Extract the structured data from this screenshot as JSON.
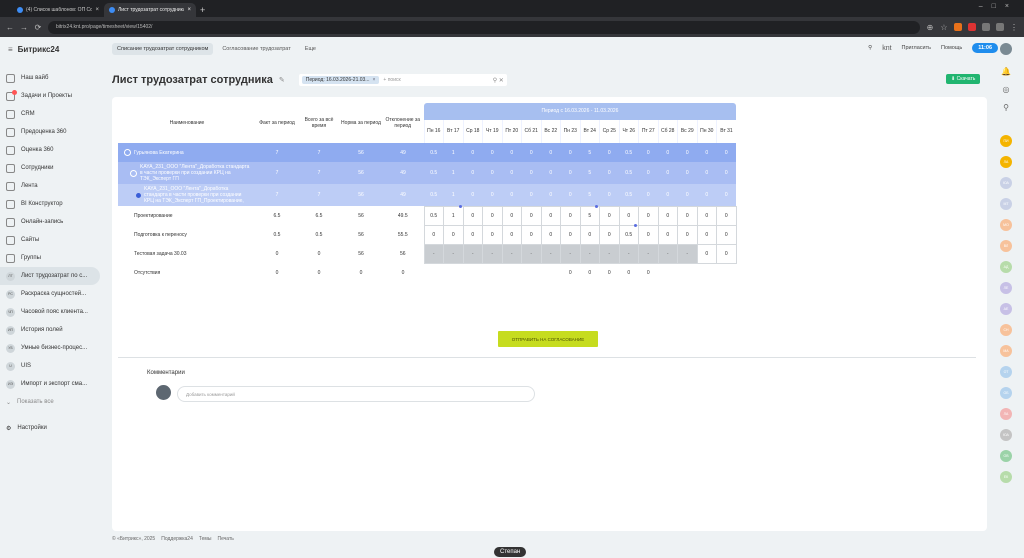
{
  "browser": {
    "tabs": [
      {
        "title": "(4) Список шаблонов: ОП Со..."
      },
      {
        "title": "Лист трудозатрат сотрудника"
      }
    ],
    "url": "bitrix24.knt.pro/page/timesheet/view/15402/"
  },
  "header": {
    "logo": "Битрикс24",
    "tabs": [
      "Списание трудозатрат сотрудником",
      "Согласование трудозатрат",
      "Еще"
    ],
    "knt": "knt",
    "invite": "Пригласить",
    "help": "Помощь",
    "clock": "11:06"
  },
  "sidebar": {
    "items": [
      {
        "label": "Наш вайб"
      },
      {
        "label": "Задачи и Проекты"
      },
      {
        "label": "CRM"
      },
      {
        "label": "Предоценка 360"
      },
      {
        "label": "Оценка 360"
      },
      {
        "label": "Сотрудники"
      },
      {
        "label": "Лента"
      },
      {
        "label": "BI Конструктор"
      },
      {
        "label": "Онлайн-запись"
      },
      {
        "label": "Сайты"
      },
      {
        "label": "Группы"
      },
      {
        "label": "Лист трудозатрат по с...",
        "icon_text": "ЛТ"
      },
      {
        "label": "Раскраска сущностей...",
        "icon_text": "РС"
      },
      {
        "label": "Часовой пояс клиента...",
        "icon_text": "ЧП"
      },
      {
        "label": "История полей",
        "icon_text": "ИП"
      },
      {
        "label": "Умные бизнес-процес...",
        "icon_text": "УБ"
      },
      {
        "label": "UIS",
        "icon_text": "U"
      },
      {
        "label": "Импорт и экспорт сма...",
        "icon_text": "ИЭ"
      }
    ],
    "show_all": "Показать все",
    "settings": "Настройки"
  },
  "page": {
    "title": "Лист трудозатрат сотрудника",
    "filter_chip": "Период: 16.03.2026-21.03...",
    "search_placeholder": "+ поиск",
    "export_label": "Скачать"
  },
  "table": {
    "headers": {
      "name": "Наименование",
      "fact": "Факт за период",
      "total": "Всего за всё время",
      "norm": "Норма за период",
      "deviation": "Отклонение за период"
    },
    "period_label": "Период с 16.03.2026 - 11.03.2026",
    "days": [
      "Пн 16",
      "Вт 17",
      "Ср 18",
      "Чт 19",
      "Пт 20",
      "Сб 21",
      "Вс 22",
      "Пн 23",
      "Вт 24",
      "Ср 25",
      "Чт 26",
      "Пт 27",
      "Сб 28",
      "Вс 29",
      "Пн 30",
      "Вт 31"
    ],
    "rows": [
      {
        "name": "Гурьянова Екатерина",
        "fact": "7",
        "total": "7",
        "norm": "56",
        "dev": "49",
        "cells": [
          "0.5",
          "1",
          "0",
          "0",
          "0",
          "0",
          "0",
          "0",
          "5",
          "0",
          "0.5",
          "0",
          "0",
          "0",
          "0",
          "0"
        ]
      },
      {
        "name": "KAYA_231_ООО \"Лента\"_Доработка стандарта в части проверки при создании КРЦ на ТЭК_Эксперт ГП",
        "fact": "7",
        "total": "7",
        "norm": "56",
        "dev": "49",
        "cells": [
          "0.5",
          "1",
          "0",
          "0",
          "0",
          "0",
          "0",
          "0",
          "5",
          "0",
          "0.5",
          "0",
          "0",
          "0",
          "0",
          "0"
        ]
      },
      {
        "name": "KAYA_231_ООО \"Лента\"_Доработка стандарта в части проверки при создании КРЦ на ТЭК_Эксперт ГП_Проектирование, разработка, КП",
        "fact": "7",
        "total": "7",
        "norm": "56",
        "dev": "49",
        "cells": [
          "0.5",
          "1",
          "0",
          "0",
          "0",
          "0",
          "0",
          "0",
          "5",
          "0",
          "0.5",
          "0",
          "0",
          "0",
          "0",
          "0"
        ]
      },
      {
        "name": "Проектирование",
        "fact": "6.5",
        "total": "6.5",
        "norm": "56",
        "dev": "49.5",
        "cells": [
          "0.5",
          "1",
          "0",
          "0",
          "0",
          "0",
          "0",
          "0",
          "5",
          "0",
          "0",
          "0",
          "0",
          "0",
          "0",
          "0"
        ]
      },
      {
        "name": "Подготовка к переносу",
        "fact": "0.5",
        "total": "0.5",
        "norm": "56",
        "dev": "55.5",
        "cells": [
          "0",
          "0",
          "0",
          "0",
          "0",
          "0",
          "0",
          "0",
          "0",
          "0",
          "0.5",
          "0",
          "0",
          "0",
          "0",
          "0"
        ]
      },
      {
        "name": "Тестовая задача 30.03",
        "fact": "0",
        "total": "0",
        "norm": "56",
        "dev": "56",
        "cells": [
          "-",
          "-",
          "-",
          "-",
          "-",
          "-",
          "-",
          "-",
          "-",
          "-",
          "-",
          "-",
          "-",
          "-",
          "0",
          "0"
        ]
      },
      {
        "name": "Отсутствия",
        "fact": "0",
        "total": "0",
        "norm": "0",
        "dev": "0",
        "cells": [
          "",
          "",
          "",
          "",
          "",
          "",
          "",
          "0",
          "0",
          "0",
          "0",
          "0",
          "",
          "",
          "",
          ""
        ]
      }
    ]
  },
  "send_button": "ОТПРАВИТЬ НА СОГЛАСОВАНИЕ",
  "comments": {
    "title": "Комментарии",
    "placeholder": "Добавить комментарий"
  },
  "footer": {
    "copyright": "© «Битрикс», 2025",
    "support": "Поддержка24",
    "themes": "Темы",
    "print": "Печать"
  },
  "user_badge": "Степан",
  "right_avatars": [
    "ПИ",
    "ЛА",
    "ЮА",
    "МТ",
    "МО",
    "ВЛ",
    "АД",
    "ЛЕ",
    "АЕ",
    "СН",
    "МА",
    "ОТ",
    "ОБ",
    "ЛА",
    "ЮА",
    "ОВ",
    "ЕК"
  ],
  "colors": {
    "accent": "#1f8ded",
    "period_header": "#a7bff0",
    "send": "#c6dc1f",
    "export": "#21b570"
  }
}
